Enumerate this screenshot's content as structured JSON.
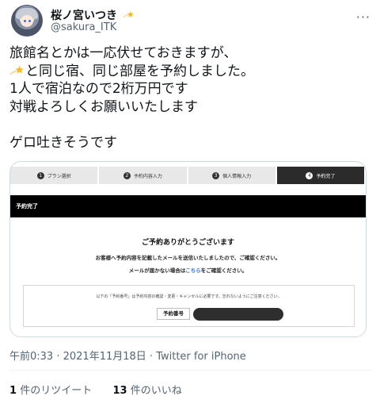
{
  "author": {
    "display_name": "桜ノ宮いつき",
    "handle": "@sakura_ITK",
    "badge_icon": "shooting-star-icon"
  },
  "tweet": {
    "lines": [
      "旅館名とかは一応伏せておきますが、",
      "と同じ宿、同じ部屋を予約しました。",
      "1人で宿泊なので2桁万円です",
      "対戦よろしくお願いいたします",
      "",
      "ゲロ吐きそうです"
    ],
    "inline_emoji": "shooting-star-icon"
  },
  "media": {
    "steps": [
      {
        "num": "1",
        "label": "プラン選択"
      },
      {
        "num": "2",
        "label": "予約内容入力"
      },
      {
        "num": "3",
        "label": "個人情報入力"
      },
      {
        "num": "4",
        "label": "予約完了"
      }
    ],
    "header": "予約完了",
    "thanks": "ご予約ありがとうございます",
    "sent_message": "お客様へ予約内容を記載したメールを送信いたしましたので、ご確認ください。",
    "nomail_prefix": "メールが届かない場合は",
    "nomail_link": "こちら",
    "nomail_suffix": "をご確認ください。",
    "number_note": "以下の「予約番号」は予約内容の確認・変更・キャンセルに必要です。忘れないようにご注意ください。",
    "number_label": "予約番号"
  },
  "meta": {
    "time": "午前0:33",
    "date": "2021年11月18日",
    "source": "Twitter for iPhone",
    "separator": " · "
  },
  "stats": {
    "retweets_count": "1",
    "retweets_label": "件のリツイート",
    "likes_count": "13",
    "likes_label": "件のいいね"
  },
  "colors": {
    "text": "#0f1419",
    "secondary": "#536471",
    "link": "#2a6fdb",
    "step_active": "#2b2b2b"
  }
}
